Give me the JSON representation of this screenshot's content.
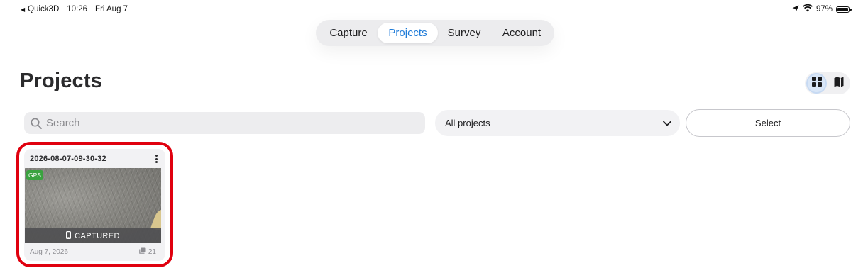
{
  "status_bar": {
    "back_app": "Quick3D",
    "time": "10:26",
    "date": "Fri Aug 7",
    "battery": "97%",
    "battery_level": 0.97
  },
  "tabs": [
    {
      "label": "Capture",
      "active": false
    },
    {
      "label": "Projects",
      "active": true
    },
    {
      "label": "Survey",
      "active": false
    },
    {
      "label": "Account",
      "active": false
    }
  ],
  "page": {
    "title": "Projects"
  },
  "view_toggle": {
    "options": [
      "grid-icon",
      "map-icon"
    ],
    "active": "grid-icon"
  },
  "search": {
    "placeholder": "Search",
    "value": ""
  },
  "filter": {
    "selected": "All projects"
  },
  "select_button": {
    "label": "Select"
  },
  "projects": [
    {
      "name": "2026-08-07-09-30-32",
      "badge": "GPS",
      "status": "CAPTURED",
      "date": "Aug 7, 2026",
      "photo_count": "21"
    }
  ],
  "colors": {
    "accent": "#1e7bd8",
    "highlight": "#e0000e",
    "gps_badge": "#3aa33f"
  }
}
